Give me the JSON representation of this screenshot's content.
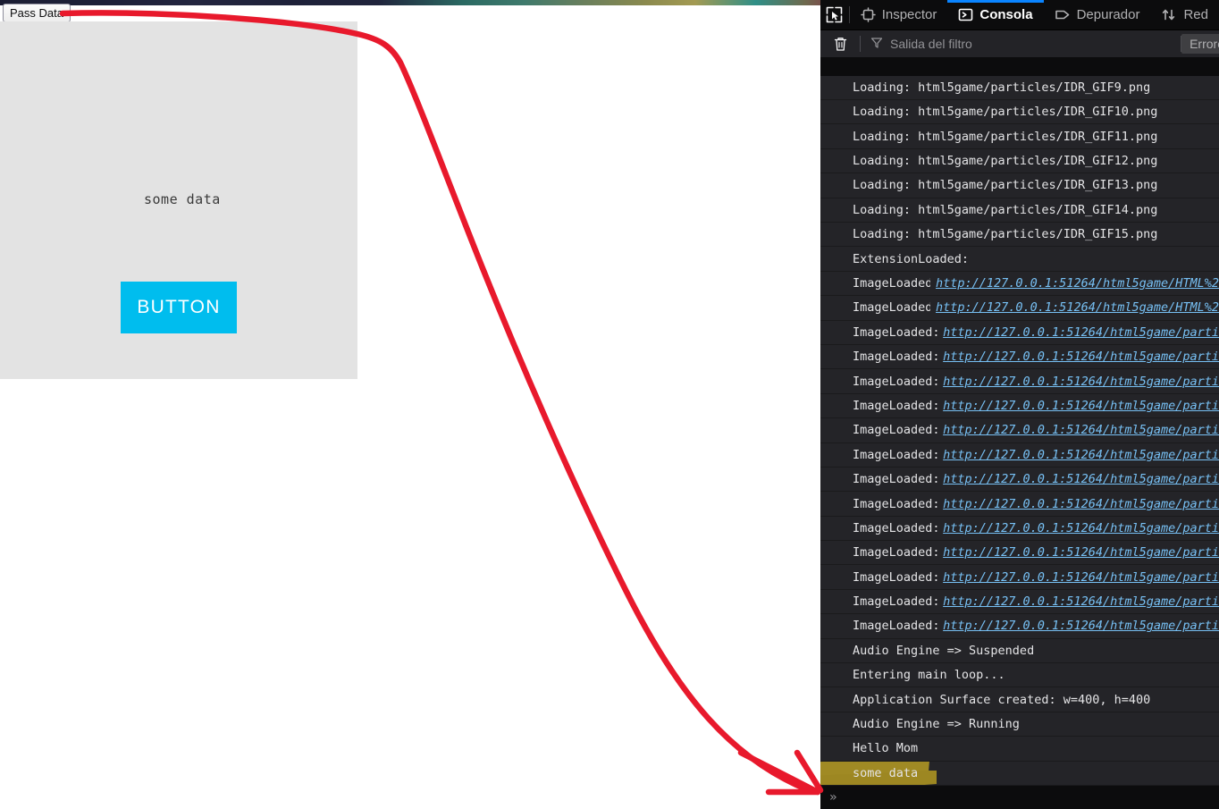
{
  "colors": {
    "accent_blue": "#0a84ff",
    "button_cyan": "#00bdee",
    "highlight_olive": "#a08a24",
    "annotation_red": "#e8192c",
    "devtools_bg": "#0c0c0d",
    "console_row_bg": "#242428",
    "canvas_bg": "#e3e3e3",
    "link_blue": "#77c0f4"
  },
  "page": {
    "pass_data_button": "Pass Data"
  },
  "canvas": {
    "text": "some data",
    "button_label": "BUTTON"
  },
  "devtools": {
    "picker_icon": "element-picker-icon",
    "tabs": [
      {
        "label": "Inspector",
        "icon": "inspector-icon",
        "active": false
      },
      {
        "label": "Consola",
        "icon": "console-icon",
        "active": true
      },
      {
        "label": "Depurador",
        "icon": "debugger-icon",
        "active": false
      },
      {
        "label": "Red",
        "icon": "network-icon",
        "active": false
      }
    ],
    "filterbar": {
      "trash_icon": "trash-icon",
      "filter_icon": "filter-icon",
      "filter_placeholder": "Salida del filtro",
      "errors_button": "Errores"
    },
    "prompt_symbol": "»"
  },
  "console_logs": [
    {
      "text": "Loading: html5game/particles/IDR_GIF9.png",
      "url": null,
      "highlighted": false,
      "clipped_top": true
    },
    {
      "text": "Loading: html5game/particles/IDR_GIF10.png",
      "url": null,
      "highlighted": false
    },
    {
      "text": "Loading: html5game/particles/IDR_GIF11.png",
      "url": null,
      "highlighted": false
    },
    {
      "text": "Loading: html5game/particles/IDR_GIF12.png",
      "url": null,
      "highlighted": false
    },
    {
      "text": "Loading: html5game/particles/IDR_GIF13.png",
      "url": null,
      "highlighted": false
    },
    {
      "text": "Loading: html5game/particles/IDR_GIF14.png",
      "url": null,
      "highlighted": false
    },
    {
      "text": "Loading: html5game/particles/IDR_GIF15.png",
      "url": null,
      "highlighted": false
    },
    {
      "text": "ExtensionLoaded:",
      "url": null,
      "highlighted": false
    },
    {
      "text": "ImageLoaded:",
      "url": "http://127.0.0.1:51264/html5game/HTML%2",
      "highlighted": false
    },
    {
      "text": "ImageLoaded:",
      "url": "http://127.0.0.1:51264/html5game/HTML%2",
      "highlighted": false
    },
    {
      "text": "ImageLoaded:",
      "url": "http://127.0.0.1:51264/html5game/parti",
      "highlighted": false
    },
    {
      "text": "ImageLoaded:",
      "url": "http://127.0.0.1:51264/html5game/parti",
      "highlighted": false
    },
    {
      "text": "ImageLoaded:",
      "url": "http://127.0.0.1:51264/html5game/parti",
      "highlighted": false
    },
    {
      "text": "ImageLoaded:",
      "url": "http://127.0.0.1:51264/html5game/parti",
      "highlighted": false
    },
    {
      "text": "ImageLoaded:",
      "url": "http://127.0.0.1:51264/html5game/parti",
      "highlighted": false
    },
    {
      "text": "ImageLoaded:",
      "url": "http://127.0.0.1:51264/html5game/parti",
      "highlighted": false
    },
    {
      "text": "ImageLoaded:",
      "url": "http://127.0.0.1:51264/html5game/parti",
      "highlighted": false
    },
    {
      "text": "ImageLoaded:",
      "url": "http://127.0.0.1:51264/html5game/parti",
      "highlighted": false
    },
    {
      "text": "ImageLoaded:",
      "url": "http://127.0.0.1:51264/html5game/parti",
      "highlighted": false
    },
    {
      "text": "ImageLoaded:",
      "url": "http://127.0.0.1:51264/html5game/parti",
      "highlighted": false
    },
    {
      "text": "ImageLoaded:",
      "url": "http://127.0.0.1:51264/html5game/parti",
      "highlighted": false
    },
    {
      "text": "ImageLoaded:",
      "url": "http://127.0.0.1:51264/html5game/parti",
      "highlighted": false
    },
    {
      "text": "ImageLoaded:",
      "url": "http://127.0.0.1:51264/html5game/parti",
      "highlighted": false
    },
    {
      "text": "Audio Engine => Suspended",
      "url": null,
      "highlighted": false
    },
    {
      "text": "Entering main loop...",
      "url": null,
      "highlighted": false
    },
    {
      "text": "Application Surface created: w=400, h=400",
      "url": null,
      "highlighted": false
    },
    {
      "text": "Audio Engine => Running",
      "url": null,
      "highlighted": false
    },
    {
      "text": "Hello Mom",
      "url": null,
      "highlighted": false
    },
    {
      "text": "some data",
      "url": null,
      "highlighted": true
    }
  ],
  "annotation": {
    "type": "hand-drawn-arrow",
    "from": "Pass Data button",
    "to": "some data console log entry",
    "color": "#e8192c"
  }
}
